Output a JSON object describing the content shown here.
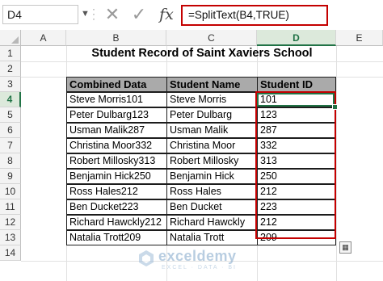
{
  "formula_bar": {
    "name_box": "D4",
    "formula": "=SplitText(B4,TRUE)",
    "cancel_icon": "✕",
    "enter_icon": "✓",
    "fx_label": "fx"
  },
  "columns": [
    "A",
    "B",
    "C",
    "D",
    "E"
  ],
  "rows": [
    "1",
    "2",
    "3",
    "4",
    "5",
    "6",
    "7",
    "8",
    "9",
    "10",
    "11",
    "12",
    "13",
    "14"
  ],
  "selected_column": "D",
  "selected_row": "4",
  "title": "Student Record of Saint Xaviers School",
  "table": {
    "headers": [
      "Combined Data",
      "Student Name",
      "Student ID"
    ],
    "rows": [
      [
        "Steve Morris101",
        "Steve Morris",
        "101"
      ],
      [
        "Peter Dulbarg123",
        "Peter Dulbarg",
        "123"
      ],
      [
        "Usman Malik287",
        "Usman Malik",
        "287"
      ],
      [
        "Christina Moor332",
        "Christina Moor",
        "332"
      ],
      [
        "Robert Millosky313",
        "Robert Millosky",
        "313"
      ],
      [
        "Benjamin Hick250",
        "Benjamin Hick",
        "250"
      ],
      [
        "Ross Hales212",
        "Ross Hales",
        "212"
      ],
      [
        "Ben Ducket223",
        "Ben Ducket",
        "223"
      ],
      [
        "Richard Hawckly212",
        "Richard Hawckly",
        "212"
      ],
      [
        "Natalia Trott209",
        "Natalia Trott",
        "209"
      ]
    ]
  },
  "colors": {
    "highlight_red": "#c40000",
    "excel_green": "#217346",
    "header_gray": "#aaaaaa"
  },
  "watermark": {
    "brand": "exceldemy",
    "tagline": "EXCEL · DATA · BI"
  }
}
